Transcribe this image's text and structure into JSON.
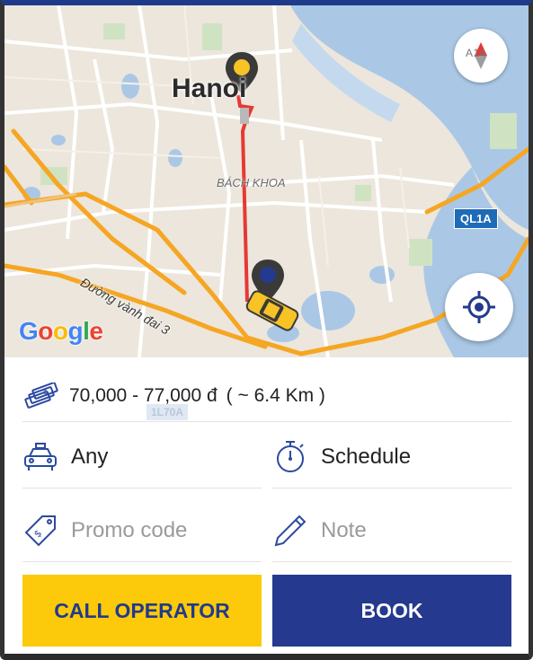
{
  "map": {
    "city_label": "Hanoi",
    "district_label": "BÁCH KHOA",
    "road_label": "Đường vành đai 3",
    "shield_label": "QL1A",
    "faded_shield_label": "1L70A",
    "google_letters": [
      "G",
      "o",
      "o",
      "g",
      "l",
      "e"
    ],
    "compass_text": "A14"
  },
  "fare": {
    "price_range": "70,000 - 77,000 đ",
    "distance": "( ~ 6.4 Km )"
  },
  "options": {
    "vehicle_label": "Any",
    "schedule_label": "Schedule",
    "promo_placeholder": "Promo code",
    "note_placeholder": "Note"
  },
  "actions": {
    "call_label": "CALL OPERATOR",
    "book_label": "BOOK"
  },
  "colors": {
    "accent_yellow": "#fcca0a",
    "brand_blue": "#253a8e",
    "route_red": "#e53935",
    "icon_blue": "#2b4aa0"
  }
}
